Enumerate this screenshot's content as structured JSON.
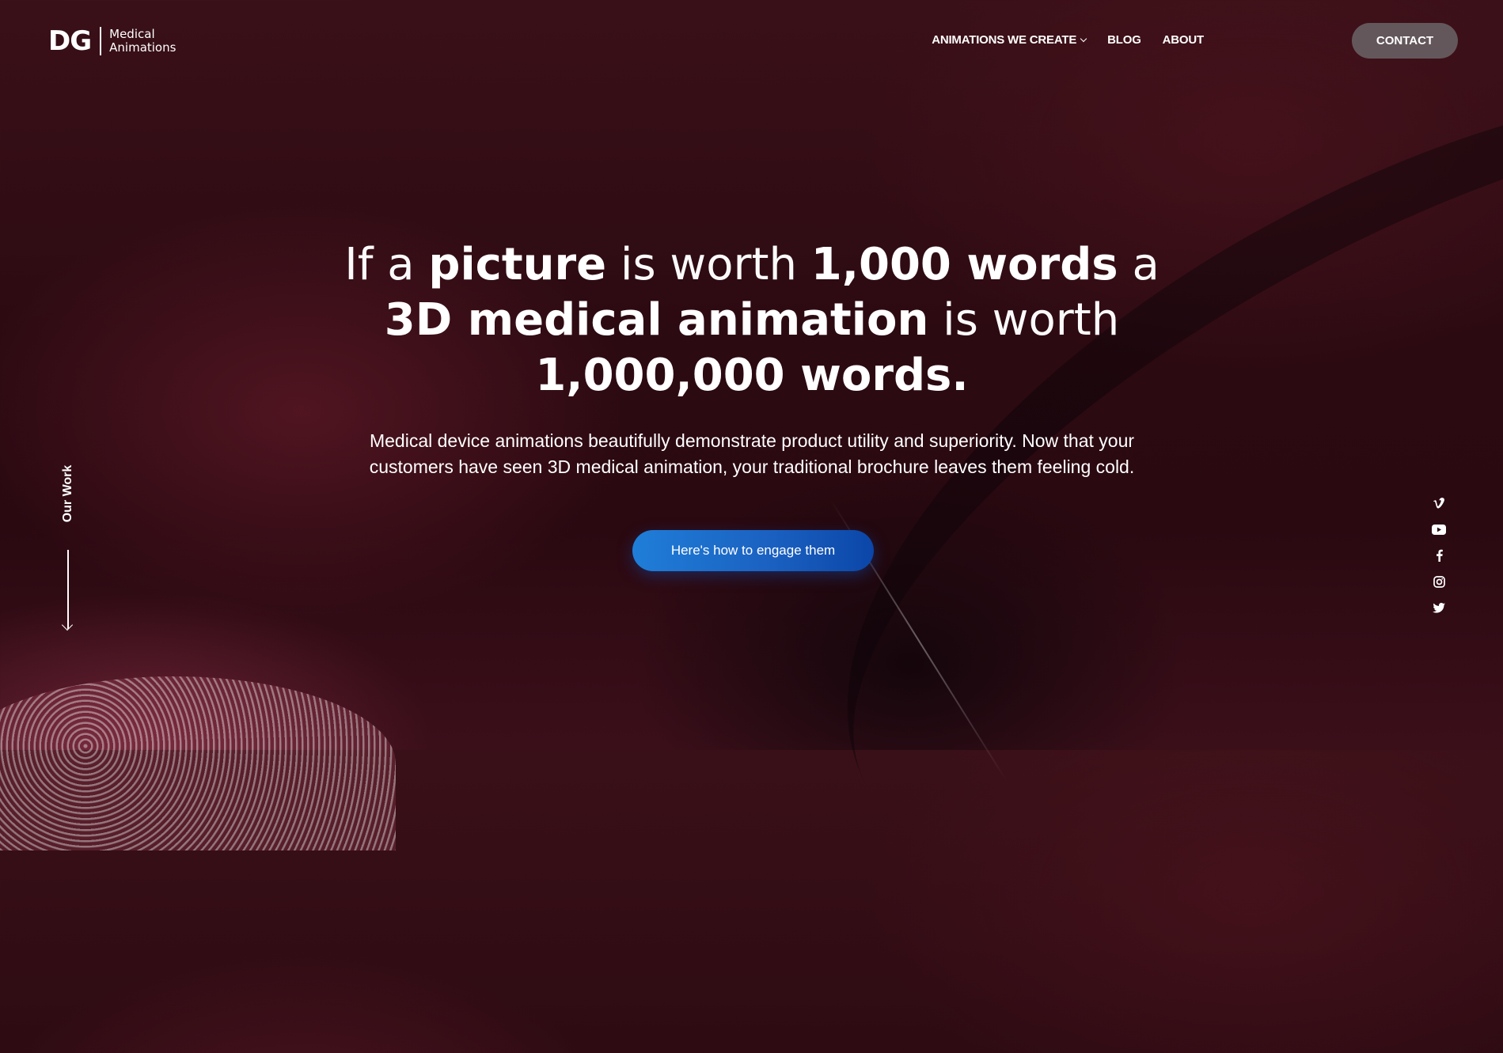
{
  "logo": {
    "mark": "DG",
    "line1": "Medical",
    "line2": "Animations"
  },
  "nav": {
    "items": [
      {
        "label": "ANIMATIONS WE CREATE",
        "has_dropdown": true
      },
      {
        "label": "BLOG",
        "has_dropdown": false
      },
      {
        "label": "ABOUT",
        "has_dropdown": false
      }
    ],
    "contact_label": "CONTACT"
  },
  "hero": {
    "title_parts": {
      "p1": "If a ",
      "p2": "picture",
      "p3": " is worth ",
      "p4": "1,000 words",
      "p5": " a",
      "p6": "3D medical animation",
      "p7": " is worth",
      "p8": "1,000,000 words."
    },
    "subtitle": "Medical device animations beautifully demonstrate product utility and superiority. Now that your customers have seen 3D medical animation, your traditional brochure leaves them feeling cold.",
    "cta_label": "Here's how to engage them"
  },
  "side": {
    "our_work_label": "Our Work"
  },
  "social": {
    "icons": [
      "vimeo-icon",
      "youtube-icon",
      "facebook-icon",
      "instagram-icon",
      "twitter-icon"
    ]
  },
  "colors": {
    "cta_start": "#1f7ed8",
    "cta_end": "#0b46a8",
    "contact_bg": "#6e6c70",
    "background": "#2c0a12"
  }
}
